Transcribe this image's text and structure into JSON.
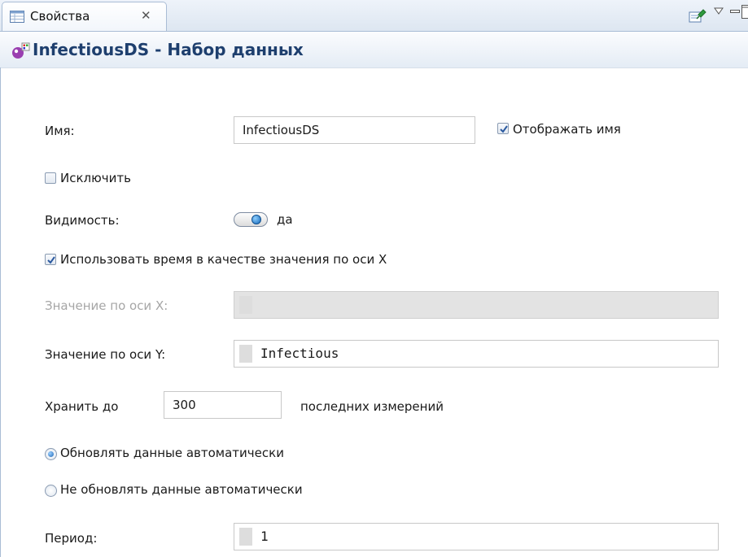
{
  "tab": {
    "label": "Свойства",
    "close": "✕"
  },
  "header": {
    "title": "InfectiousDS - Набор данных"
  },
  "form": {
    "name_label": "Имя:",
    "name_value": "InfectiousDS",
    "show_name_label": "Отображать имя",
    "show_name_checked": true,
    "exclude_label": "Исключить",
    "exclude_checked": false,
    "visibility_label": "Видимость:",
    "visibility_value": "да",
    "use_time_label": "Использовать время в качестве значения по оси X",
    "use_time_checked": true,
    "x_value_label": "Значение по оси X:",
    "x_value": "",
    "y_value_label": "Значение по оси Y:",
    "y_value": "Infectious",
    "keep_label": "Хранить до",
    "keep_value": "300",
    "keep_suffix": "последних измерений",
    "radio_auto_label": "Обновлять данные автоматически",
    "radio_manual_label": "Не обновлять данные автоматически",
    "update_mode": "auto",
    "period_label": "Период:",
    "period_value": "1"
  },
  "icons": {
    "tab": "properties-table-icon",
    "pin": "pin-icon",
    "view_menu": "view-menu-chevron-icon",
    "minimize": "minimize-icon",
    "maximize": "maximize-icon",
    "dataset": "dataset-icon"
  },
  "colors": {
    "header_title": "#1e3f6e",
    "accent": "#1f66b5",
    "disabled_text": "#a6a6a6",
    "disabled_bg": "#e3e3e3"
  }
}
